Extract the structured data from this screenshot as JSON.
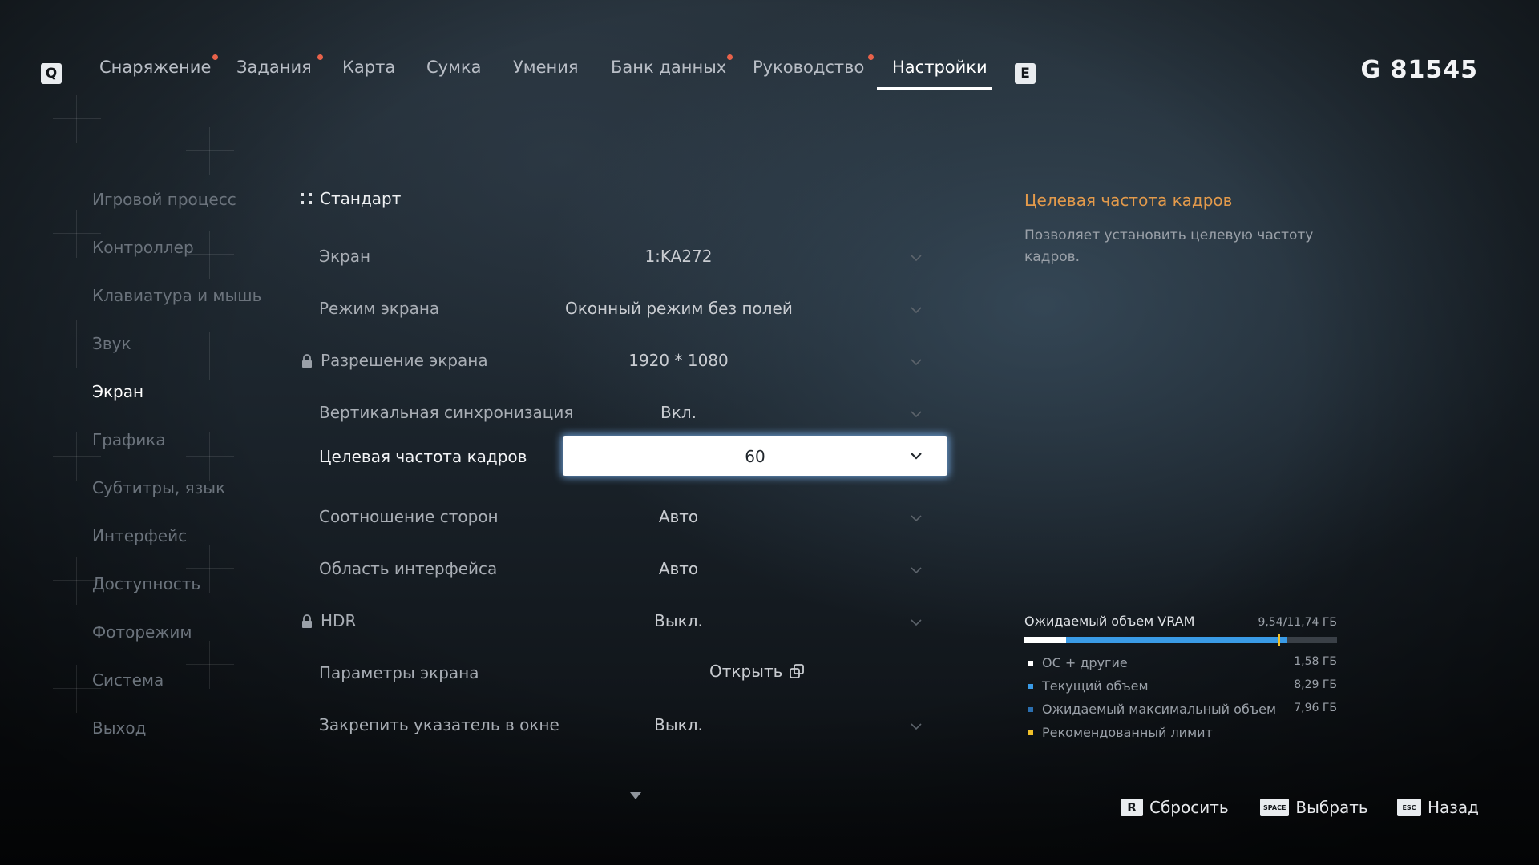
{
  "topbar": {
    "left_key": "Q",
    "right_key": "E",
    "tabs": [
      {
        "label": "Снаряжение",
        "dot": true
      },
      {
        "label": "Задания",
        "dot": true
      },
      {
        "label": "Карта",
        "dot": false
      },
      {
        "label": "Сумка",
        "dot": false
      },
      {
        "label": "Умения",
        "dot": false
      },
      {
        "label": "Банк данных",
        "dot": true
      },
      {
        "label": "Руководство",
        "dot": true
      },
      {
        "label": "Настройки",
        "dot": false,
        "active": true
      }
    ],
    "currency": "G 81545"
  },
  "sidebar": {
    "items": [
      {
        "label": "Игровой процесс"
      },
      {
        "label": "Контроллер"
      },
      {
        "label": "Клавиатура и мышь"
      },
      {
        "label": "Звук"
      },
      {
        "label": "Экран",
        "active": true
      },
      {
        "label": "Графика"
      },
      {
        "label": "Субтитры, язык"
      },
      {
        "label": "Интерфейс"
      },
      {
        "label": "Доступность"
      },
      {
        "label": "Фоторежим"
      },
      {
        "label": "Система"
      },
      {
        "label": "Выход"
      }
    ]
  },
  "settings": {
    "section_title": "Стандарт",
    "rows": [
      {
        "label": "Экран",
        "value": "1:KA272"
      },
      {
        "label": "Режим экрана",
        "value": "Оконный режим без полей"
      },
      {
        "label": "Разрешение экрана",
        "value": "1920 * 1080",
        "locked": true
      },
      {
        "label": "Вертикальная синхронизация",
        "value": "Вкл."
      },
      {
        "label": "Целевая частота кадров",
        "value": "60",
        "selected": true
      },
      {
        "label": "Соотношение сторон",
        "value": "Авто"
      },
      {
        "label": "Область интерфейса",
        "value": "Авто"
      },
      {
        "label": "HDR",
        "value": "Выкл.",
        "locked": true
      },
      {
        "label": "Параметры экрана",
        "value": "Открыть"
      },
      {
        "label": "Закрепить указатель в окне",
        "value": "Выкл."
      }
    ]
  },
  "info": {
    "title": "Целевая частота кадров",
    "description": "Позволяет установить целевую частоту кадров."
  },
  "vram": {
    "title": "Ожидаемый объем VRAM",
    "total": "9,54/11,74 ГБ",
    "bar": {
      "total_gb": 11.74,
      "os_gb": 1.58,
      "current_gb": 8.29,
      "limit_gb": 9.54
    },
    "legend": [
      {
        "label": "ОС + другие",
        "value": "1,58 ГБ",
        "color": "#ffffff"
      },
      {
        "label": "Текущий объем",
        "value": "8,29 ГБ",
        "color": "#3a9be6"
      },
      {
        "label": "Ожидаемый максимальный объем",
        "value": "7,96 ГБ",
        "color": "#2b6fb0"
      },
      {
        "label": "Рекомендованный лимит",
        "value": "",
        "color": "#f0c02a"
      }
    ]
  },
  "hints": {
    "reset_key": "R",
    "reset_label": "Сбросить",
    "select_key": "SPACE",
    "select_label": "Выбрать",
    "back_key": "ESC",
    "back_label": "Назад"
  }
}
